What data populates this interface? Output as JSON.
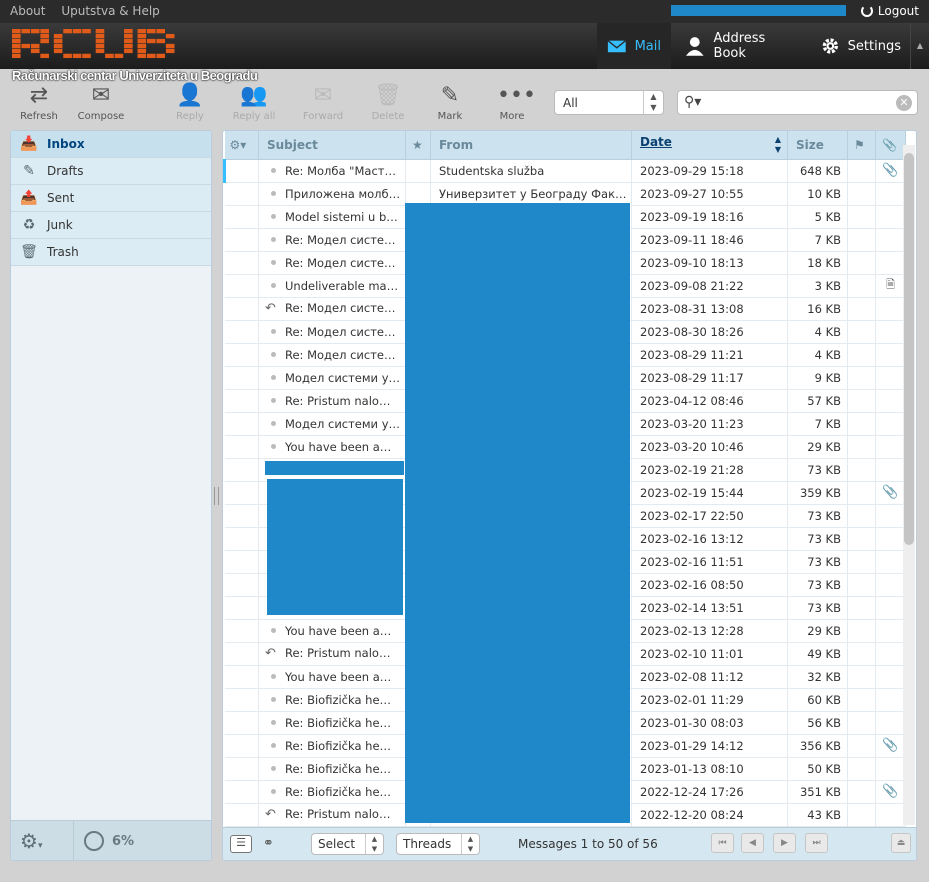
{
  "topline": {
    "links": [
      "About",
      "Uputstva & Help"
    ],
    "logout": "Logout"
  },
  "brand": {
    "subtitle": "Računarski centar Univerziteta u Beogradu",
    "logo_color": "#e05a1a"
  },
  "taskbar": {
    "mail": "Mail",
    "address_book": "Address Book",
    "settings": "Settings"
  },
  "toolbar": {
    "refresh": "Refresh",
    "compose": "Compose",
    "reply": "Reply",
    "reply_all": "Reply all",
    "forward": "Forward",
    "delete": "Delete",
    "mark": "Mark",
    "more": "More"
  },
  "filter": {
    "value": "All"
  },
  "folders": [
    {
      "label": "Inbox",
      "icon": "inbox-icon",
      "selected": true
    },
    {
      "label": "Drafts",
      "icon": "pencil-icon"
    },
    {
      "label": "Sent",
      "icon": "sent-icon"
    },
    {
      "label": "Junk",
      "icon": "junk-icon"
    },
    {
      "label": "Trash",
      "icon": "trash-icon"
    }
  ],
  "quota": "6%",
  "columns": {
    "subject": "Subject",
    "from": "From",
    "date": "Date",
    "size": "Size"
  },
  "messages": [
    {
      "subject": "Re: Молба \"Маст…",
      "from": "Studentska služba",
      "date": "2023-09-29 15:18",
      "size": "648 KB",
      "flag": "clip"
    },
    {
      "subject": "Приложена молб…",
      "from": "Универзитет у Београду Факу…",
      "date": "2023-09-27 10:55",
      "size": "10 KB"
    },
    {
      "subject": "Model sistemi u b…",
      "from": "",
      "date": "2023-09-19 18:16",
      "size": "5 KB"
    },
    {
      "subject": "Re: Модел систе…",
      "from": "",
      "date": "2023-09-11 18:46",
      "size": "7 KB"
    },
    {
      "subject": "Re: Модел систе…",
      "from": "",
      "date": "2023-09-10 18:13",
      "size": "18 KB"
    },
    {
      "subject": "Undeliverable ma…",
      "from": "",
      "date": "2023-09-08 21:22",
      "size": "3 KB",
      "flag": "doc"
    },
    {
      "subject": "Re: Модел систе…",
      "from": "",
      "date": "2023-08-31 13:08",
      "size": "16 KB",
      "replied": true
    },
    {
      "subject": "Re: Модел систе…",
      "from": "",
      "date": "2023-08-30 18:26",
      "size": "4 KB"
    },
    {
      "subject": "Re: Модел систе…",
      "from": "",
      "date": "2023-08-29 11:21",
      "size": "4 KB"
    },
    {
      "subject": "Модел системи у…",
      "from": "",
      "date": "2023-08-29 11:17",
      "size": "9 KB"
    },
    {
      "subject": "Re: Pristum nalo…",
      "from": "",
      "date": "2023-04-12 08:46",
      "size": "57 KB"
    },
    {
      "subject": "Модел системи у…",
      "from": "",
      "date": "2023-03-20 11:23",
      "size": "7 KB"
    },
    {
      "subject": "You have been a…",
      "from": "",
      "date": "2023-03-20 10:46",
      "size": "29 KB"
    },
    {
      "subject": "",
      "from": "",
      "date": "2023-02-19 21:28",
      "size": "73 KB"
    },
    {
      "subject": "",
      "from": "",
      "date": "2023-02-19 15:44",
      "size": "359 KB",
      "flag": "clip"
    },
    {
      "subject": "",
      "from": "",
      "date": "2023-02-17 22:50",
      "size": "73 KB"
    },
    {
      "subject": "",
      "from": "",
      "date": "2023-02-16 13:12",
      "size": "73 KB"
    },
    {
      "subject": "",
      "from": "",
      "date": "2023-02-16 11:51",
      "size": "73 KB"
    },
    {
      "subject": "",
      "from": "",
      "date": "2023-02-16 08:50",
      "size": "73 KB"
    },
    {
      "subject": "",
      "from": "",
      "date": "2023-02-14 13:51",
      "size": "73 KB"
    },
    {
      "subject": "You have been a…",
      "from": "",
      "date": "2023-02-13 12:28",
      "size": "29 KB"
    },
    {
      "subject": "Re: Pristum nalo…",
      "from": "",
      "date": "2023-02-10 11:01",
      "size": "49 KB",
      "replied": true
    },
    {
      "subject": "You have been a…",
      "from": "",
      "date": "2023-02-08 11:12",
      "size": "32 KB"
    },
    {
      "subject": "Re: Biofizička he…",
      "from": "",
      "date": "2023-02-01 11:29",
      "size": "60 KB"
    },
    {
      "subject": "Re: Biofizička he…",
      "from": "",
      "date": "2023-01-30 08:03",
      "size": "56 KB"
    },
    {
      "subject": "Re: Biofizička he…",
      "from": "",
      "date": "2023-01-29 14:12",
      "size": "356 KB",
      "flag": "clip"
    },
    {
      "subject": "Re: Biofizička he…",
      "from": "",
      "date": "2023-01-13 08:10",
      "size": "50 KB"
    },
    {
      "subject": "Re: Biofizička he…",
      "from": "",
      "date": "2022-12-24 17:26",
      "size": "351 KB",
      "flag": "clip"
    },
    {
      "subject": "Re: Pristum nalo…",
      "from": "",
      "date": "2022-12-20 08:24",
      "size": "43 KB",
      "replied": true
    }
  ],
  "footer": {
    "select": "Select",
    "threads": "Threads",
    "count": "Messages 1 to 50 of 56"
  },
  "colors": {
    "accent": "#37beff",
    "redaction": "#1e88c8"
  }
}
